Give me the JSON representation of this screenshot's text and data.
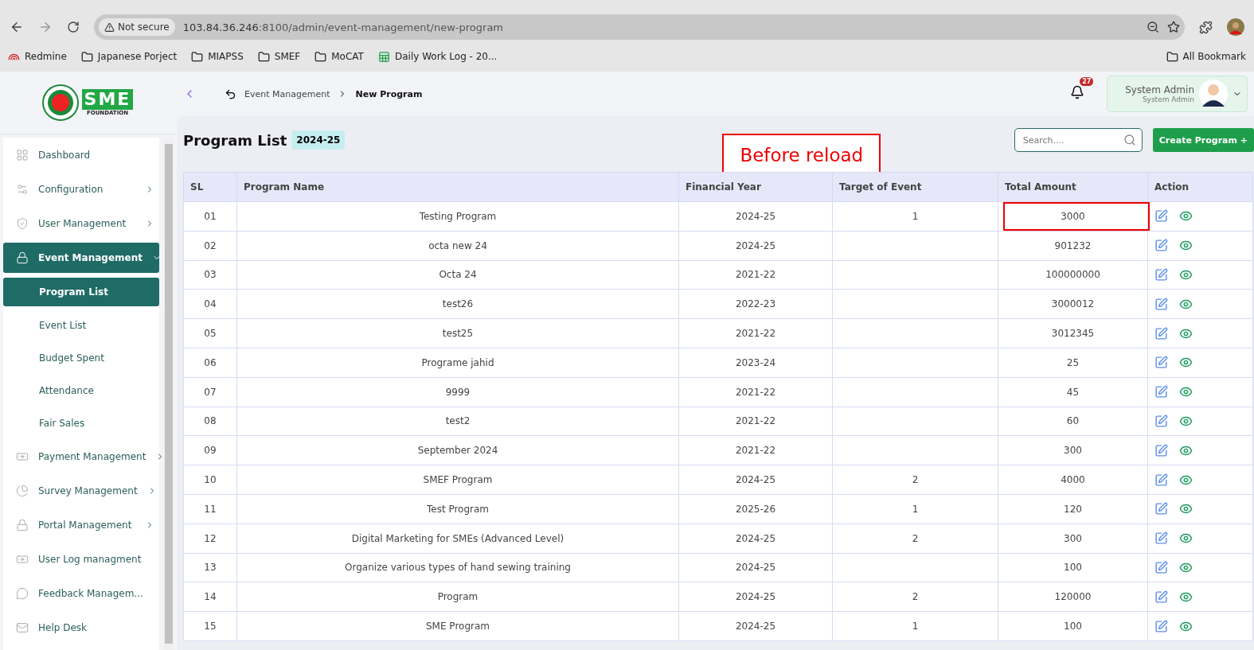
{
  "browser": {
    "security": "Not secure",
    "url_host": "103.84.36.246",
    "url_path": ":8100/admin/event-management/new-program",
    "bookmarks": [
      {
        "label": "Redmine",
        "kind": "redmine"
      },
      {
        "label": "Japanese Porject",
        "kind": "folder"
      },
      {
        "label": "MIAPSS",
        "kind": "folder"
      },
      {
        "label": "SMEF",
        "kind": "folder"
      },
      {
        "label": "MoCAT",
        "kind": "folder"
      },
      {
        "label": "Daily Work Log - 20...",
        "kind": "sheet"
      }
    ],
    "all_bookmarks": "All Bookmark"
  },
  "logo": {
    "mark": "SME",
    "sub": "FOUNDATION"
  },
  "sidebar": {
    "items": [
      {
        "label": "Dashboard",
        "kind": "grid",
        "expandable": false,
        "selected": false
      },
      {
        "label": "Configuration",
        "kind": "config",
        "expandable": true,
        "selected": false
      },
      {
        "label": "User Management",
        "kind": "shield",
        "expandable": true,
        "selected": false
      },
      {
        "label": "Event Management",
        "kind": "lock",
        "expandable": true,
        "selected": true,
        "expanded": true,
        "children": [
          {
            "label": "Program List",
            "selected": true
          },
          {
            "label": "Event List",
            "selected": false
          },
          {
            "label": "Budget Spent",
            "selected": false
          },
          {
            "label": "Attendance",
            "selected": false
          },
          {
            "label": "Fair Sales",
            "selected": false
          }
        ]
      },
      {
        "label": "Payment Management",
        "kind": "money",
        "expandable": true,
        "selected": false
      },
      {
        "label": "Survey Management",
        "kind": "pie",
        "expandable": true,
        "selected": false
      },
      {
        "label": "Portal Management",
        "kind": "lock",
        "expandable": true,
        "selected": false
      },
      {
        "label": "User Log managment",
        "kind": "money",
        "expandable": false,
        "selected": false
      },
      {
        "label": "Feedback Managem...",
        "kind": "feedback",
        "expandable": false,
        "selected": false
      },
      {
        "label": "Help Desk",
        "kind": "mail",
        "expandable": false,
        "selected": false
      }
    ]
  },
  "header": {
    "breadcrumb": [
      "Event Management",
      "New Program"
    ],
    "notifications": "27",
    "user": {
      "name": "System Admin",
      "role": "System Admin"
    }
  },
  "page": {
    "title": "Program List",
    "year": "2024-25",
    "annotation": "Before reload",
    "search": {
      "placeholder": "Search...."
    },
    "create_button": "Create Program +"
  },
  "table": {
    "columns": [
      "SL",
      "Program Name",
      "Financial Year",
      "Target of Event",
      "Total Amount",
      "Action"
    ],
    "rows": [
      {
        "sl": "01",
        "name": "Testing Program",
        "year": "2024-25",
        "target": "1",
        "amount": "3000",
        "highlighted": true
      },
      {
        "sl": "02",
        "name": "octa new 24",
        "year": "2024-25",
        "target": "",
        "amount": "901232",
        "highlighted": false
      },
      {
        "sl": "03",
        "name": "Octa 24",
        "year": "2021-22",
        "target": "",
        "amount": "100000000",
        "highlighted": false
      },
      {
        "sl": "04",
        "name": "test26",
        "year": "2022-23",
        "target": "",
        "amount": "3000012",
        "highlighted": false
      },
      {
        "sl": "05",
        "name": "test25",
        "year": "2021-22",
        "target": "",
        "amount": "3012345",
        "highlighted": false
      },
      {
        "sl": "06",
        "name": "Programe jahid",
        "year": "2023-24",
        "target": "",
        "amount": "25",
        "highlighted": false
      },
      {
        "sl": "07",
        "name": "9999",
        "year": "2021-22",
        "target": "",
        "amount": "45",
        "highlighted": false
      },
      {
        "sl": "08",
        "name": "test2",
        "year": "2021-22",
        "target": "",
        "amount": "60",
        "highlighted": false
      },
      {
        "sl": "09",
        "name": "September 2024",
        "year": "2021-22",
        "target": "",
        "amount": "300",
        "highlighted": false
      },
      {
        "sl": "10",
        "name": "SMEF Program",
        "year": "2024-25",
        "target": "2",
        "amount": "4000",
        "highlighted": false
      },
      {
        "sl": "11",
        "name": "Test Program",
        "year": "2025-26",
        "target": "1",
        "amount": "120",
        "highlighted": false
      },
      {
        "sl": "12",
        "name": "Digital Marketing for SMEs (Advanced Level)",
        "year": "2024-25",
        "target": "2",
        "amount": "300",
        "highlighted": false
      },
      {
        "sl": "13",
        "name": "Organize various types of hand sewing training",
        "year": "2024-25",
        "target": "",
        "amount": "100",
        "highlighted": false
      },
      {
        "sl": "14",
        "name": "Program",
        "year": "2024-25",
        "target": "2",
        "amount": "120000",
        "highlighted": false
      },
      {
        "sl": "15",
        "name": "SME Program",
        "year": "2024-25",
        "target": "1",
        "amount": "100",
        "highlighted": false
      }
    ]
  }
}
